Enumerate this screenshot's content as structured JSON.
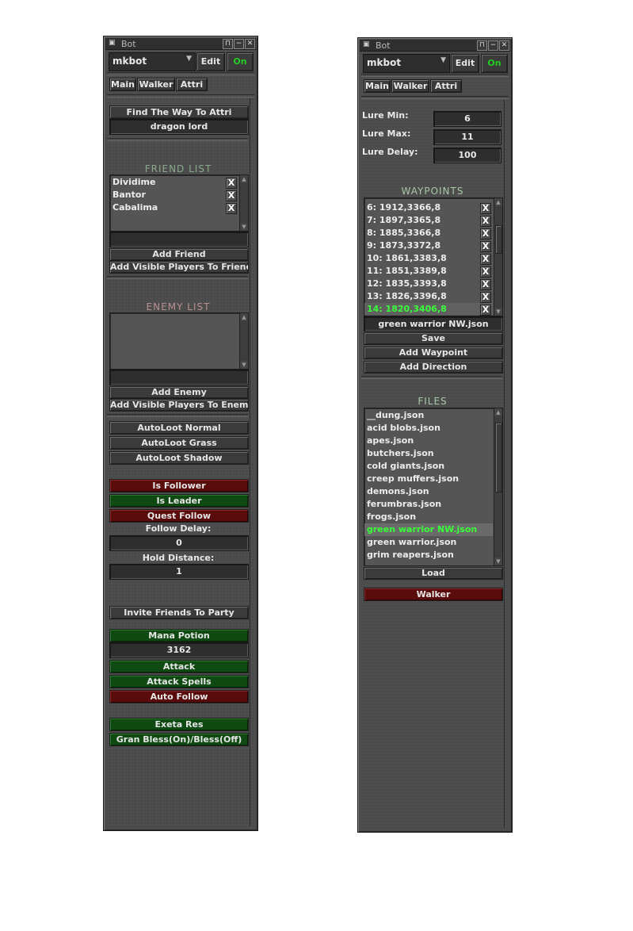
{
  "left_window": {
    "title": "Bot",
    "profile": "mkbot",
    "edit_label": "Edit",
    "on_label": "On",
    "tabs": [
      "Main",
      "Walker",
      "Attri"
    ],
    "find_way_label": "Find The Way To Attri",
    "target_value": "dragon lord",
    "friend_list_title": "FRIEND LIST",
    "friends": [
      "Dividime",
      "Bantor",
      "Cabalima"
    ],
    "remove_glyph": "X",
    "add_friend_label": "Add Friend",
    "add_visible_friends_label": "Add Visible Players To Friends",
    "enemy_list_title": "ENEMY LIST",
    "add_enemy_label": "Add Enemy",
    "add_visible_enemies_label": "Add Visible Players To Enemies",
    "autoloot_normal": "AutoLoot Normal",
    "autoloot_grass": "AutoLoot Grass",
    "autoloot_shadow": "AutoLoot Shadow",
    "is_follower": "Is Follower",
    "is_leader": "Is Leader",
    "quest_follow": "Quest Follow",
    "follow_delay_label": "Follow Delay:",
    "follow_delay_value": "0",
    "hold_distance_label": "Hold Distance:",
    "hold_distance_value": "1",
    "invite_label": "Invite Friends To Party",
    "mana_potion_label": "Mana Potion",
    "mana_potion_value": "3162",
    "attack_label": "Attack",
    "attack_spells_label": "Attack Spells",
    "auto_follow_label": "Auto Follow",
    "exeta_res_label": "Exeta Res",
    "gran_bless_label": "Gran Bless(On)/Bless(Off)"
  },
  "right_window": {
    "title": "Bot",
    "profile": "mkbot",
    "edit_label": "Edit",
    "on_label": "On",
    "tabs": [
      "Main",
      "Walker",
      "Attri"
    ],
    "lure_min_label": "Lure Min:",
    "lure_min_value": "6",
    "lure_max_label": "Lure Max:",
    "lure_max_value": "11",
    "lure_delay_label": "Lure Delay:",
    "lure_delay_value": "100",
    "waypoints_title": "WAYPOINTS",
    "waypoints": [
      "6: 1912,3366,8",
      "7: 1897,3365,8",
      "8: 1885,3366,8",
      "9: 1873,3372,8",
      "10: 1861,3383,8",
      "11: 1851,3389,8",
      "12: 1835,3393,8",
      "13: 1826,3396,8",
      "14: 1820,3406,8"
    ],
    "remove_glyph": "X",
    "current_file": "green warrior NW.json",
    "save_label": "Save",
    "add_waypoint_label": "Add Waypoint",
    "add_direction_label": "Add Direction",
    "files_title": "FILES",
    "files": [
      "__dung.json",
      "acid blobs.json",
      "apes.json",
      "butchers.json",
      "cold giants.json",
      "creep muffers.json",
      "demons.json",
      "ferumbras.json",
      "frogs.json",
      "green warrior NW.json",
      "green warrior.json",
      "grim reapers.json"
    ],
    "load_label": "Load",
    "walker_label": "Walker"
  },
  "colors": {
    "panel": "#4b4b4b",
    "green_button": "#0f4a12",
    "red_button": "#5a0c0c",
    "on_text": "#22cc22",
    "friend_title": "#8aa88a",
    "enemy_title": "#b89090",
    "section_title": "#a8c8a8",
    "active_waypoint": "#39ff39"
  },
  "icons": [
    "window-icon",
    "lock-icon",
    "minimize-icon",
    "close-icon",
    "dropdown-arrow-icon"
  ]
}
